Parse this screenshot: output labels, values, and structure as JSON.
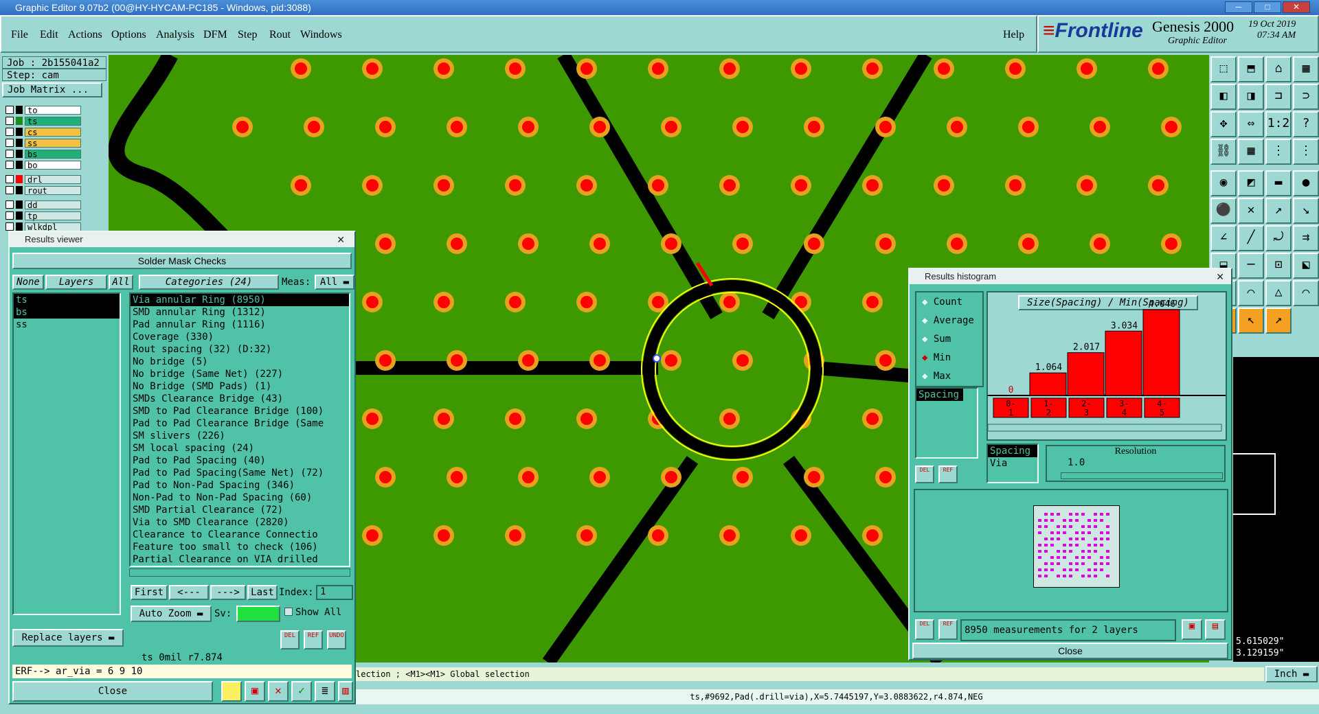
{
  "window": {
    "title": "Graphic Editor 9.07b2 (00@HY-HYCAM-PC185 - Windows, pid:3088)"
  },
  "menu": [
    "File",
    "Edit",
    "Actions",
    "Options",
    "Analysis",
    "DFM",
    "Step",
    "Rout",
    "Windows"
  ],
  "help": "Help",
  "brand": {
    "logo": "Frontline",
    "product": "Genesis 2000",
    "sub": "Graphic Editor",
    "date": "19 Oct 2019",
    "time": "07:34 AM"
  },
  "job": {
    "job": "Job : 2b155041a2",
    "step": "Step: cam",
    "matrix_button": "Job Matrix ..."
  },
  "layers": [
    {
      "name": "to",
      "color": "#000000",
      "bg": "#ffffff"
    },
    {
      "name": "ts",
      "color": "#1a8c1a",
      "bg": "#22b07a"
    },
    {
      "name": "cs",
      "color": "#000000",
      "bg": "#f4c040"
    },
    {
      "name": "ss",
      "color": "#000000",
      "bg": "#f4c040"
    },
    {
      "name": "bs",
      "color": "#000000",
      "bg": "#22b07a"
    },
    {
      "name": "bo",
      "color": "#000000",
      "bg": "#ffffff"
    },
    {
      "name": "drl",
      "color": "#ff0000",
      "bg": "#cfe8e4"
    },
    {
      "name": "rout",
      "color": "#000000",
      "bg": "#cfe8e4"
    },
    {
      "name": "dd",
      "color": "#000000",
      "bg": "#cfe8e4"
    },
    {
      "name": "tp",
      "color": "#000000",
      "bg": "#cfe8e4"
    },
    {
      "name": "wlkdpl",
      "color": "#000000",
      "bg": "#cfe8e4"
    }
  ],
  "results_viewer": {
    "title": "Results viewer",
    "header": "Solder Mask Checks",
    "none_btn": "None",
    "layers_btn": "Layers",
    "all_btn": "All",
    "categories_btn": "Categories (24)",
    "meas_label": "Meas:",
    "meas_value": "All",
    "layers": [
      "ts",
      "bs",
      "ss"
    ],
    "categories": [
      "Via annular Ring (8950)",
      "SMD annular Ring (1312)",
      "Pad annular Ring (1116)",
      "Coverage (330)",
      "Rout spacing (32)             (D:32)",
      "No bridge (5)",
      "No bridge (Same Net) (227)",
      "No Bridge (SMD Pads) (1)",
      "SMDs Clearance Bridge (43)",
      "SMD to Pad Clearance Bridge (100)",
      "Pad to Pad Clearance Bridge (Same",
      "SM slivers (226)",
      "SM local spacing (24)",
      "Pad to Pad Spacing (40)",
      "Pad to Pad Spacing(Same Net) (72)",
      "Pad to Non-Pad Spacing (346)",
      "Non-Pad to Non-Pad Spacing (60)",
      "SMD Partial Clearance (72)",
      "Via to SMD Clearance (2820)",
      "Clearance to Clearance Connectio",
      "Feature too small to check (106)",
      "Partial Clearance on VIA drilled"
    ],
    "nav": {
      "first": "First",
      "prev": "<---",
      "next": "--->",
      "last": "Last",
      "index_label": "Index:",
      "index_value": "1"
    },
    "auto_zoom": "Auto Zoom",
    "sv_label": "Sv:",
    "show_all": "Show All",
    "replace_layers": "Replace layers",
    "del": "DEL",
    "ref": "REF",
    "undo": "UNDO",
    "status": "ts  0mil   r7.874",
    "erf": "ERF--> ar_via = 6 9 10",
    "close": "Close"
  },
  "histogram": {
    "title": "Results histogram",
    "modes": [
      "Count",
      "Average",
      "Sum",
      "Min",
      "Max"
    ],
    "active_mode": "Min",
    "chart_title": "Size(Spacing) / Min(Spacing)",
    "measure_list": [
      "Spacing"
    ],
    "list2": [
      "Spacing",
      "Via"
    ],
    "resolution_label": "Resolution",
    "resolution_value": "1.0",
    "measurements": "8950 measurements for 2 layers",
    "close": "Close"
  },
  "chart_data": {
    "type": "bar",
    "title": "Size(Spacing) / Min(Spacing)",
    "categories": [
      "0-1",
      "1-2",
      "2-3",
      "3-4",
      "4-5"
    ],
    "values": [
      0,
      1.064,
      2.017,
      3.034,
      4.046
    ],
    "value_labels": [
      "0",
      "1.064",
      "2.017",
      "3.034",
      "4.046"
    ]
  },
  "command_line": "lection ; <M1><M1> Global selection",
  "status_bar": "ts,#9692,Pad(.drill=via),X=5.7445197,Y=3.0883622,r4.874,NEG",
  "coords": {
    "x": "5.615029\"",
    "y": "3.129159\""
  },
  "units": "Inch",
  "colors": {
    "board": "#3e9900",
    "pad_outer": "#e8a020",
    "pad_inner": "#ff0000",
    "trace": "#000000",
    "panel": "#9ed8d2",
    "window": "#4fc2a8"
  }
}
